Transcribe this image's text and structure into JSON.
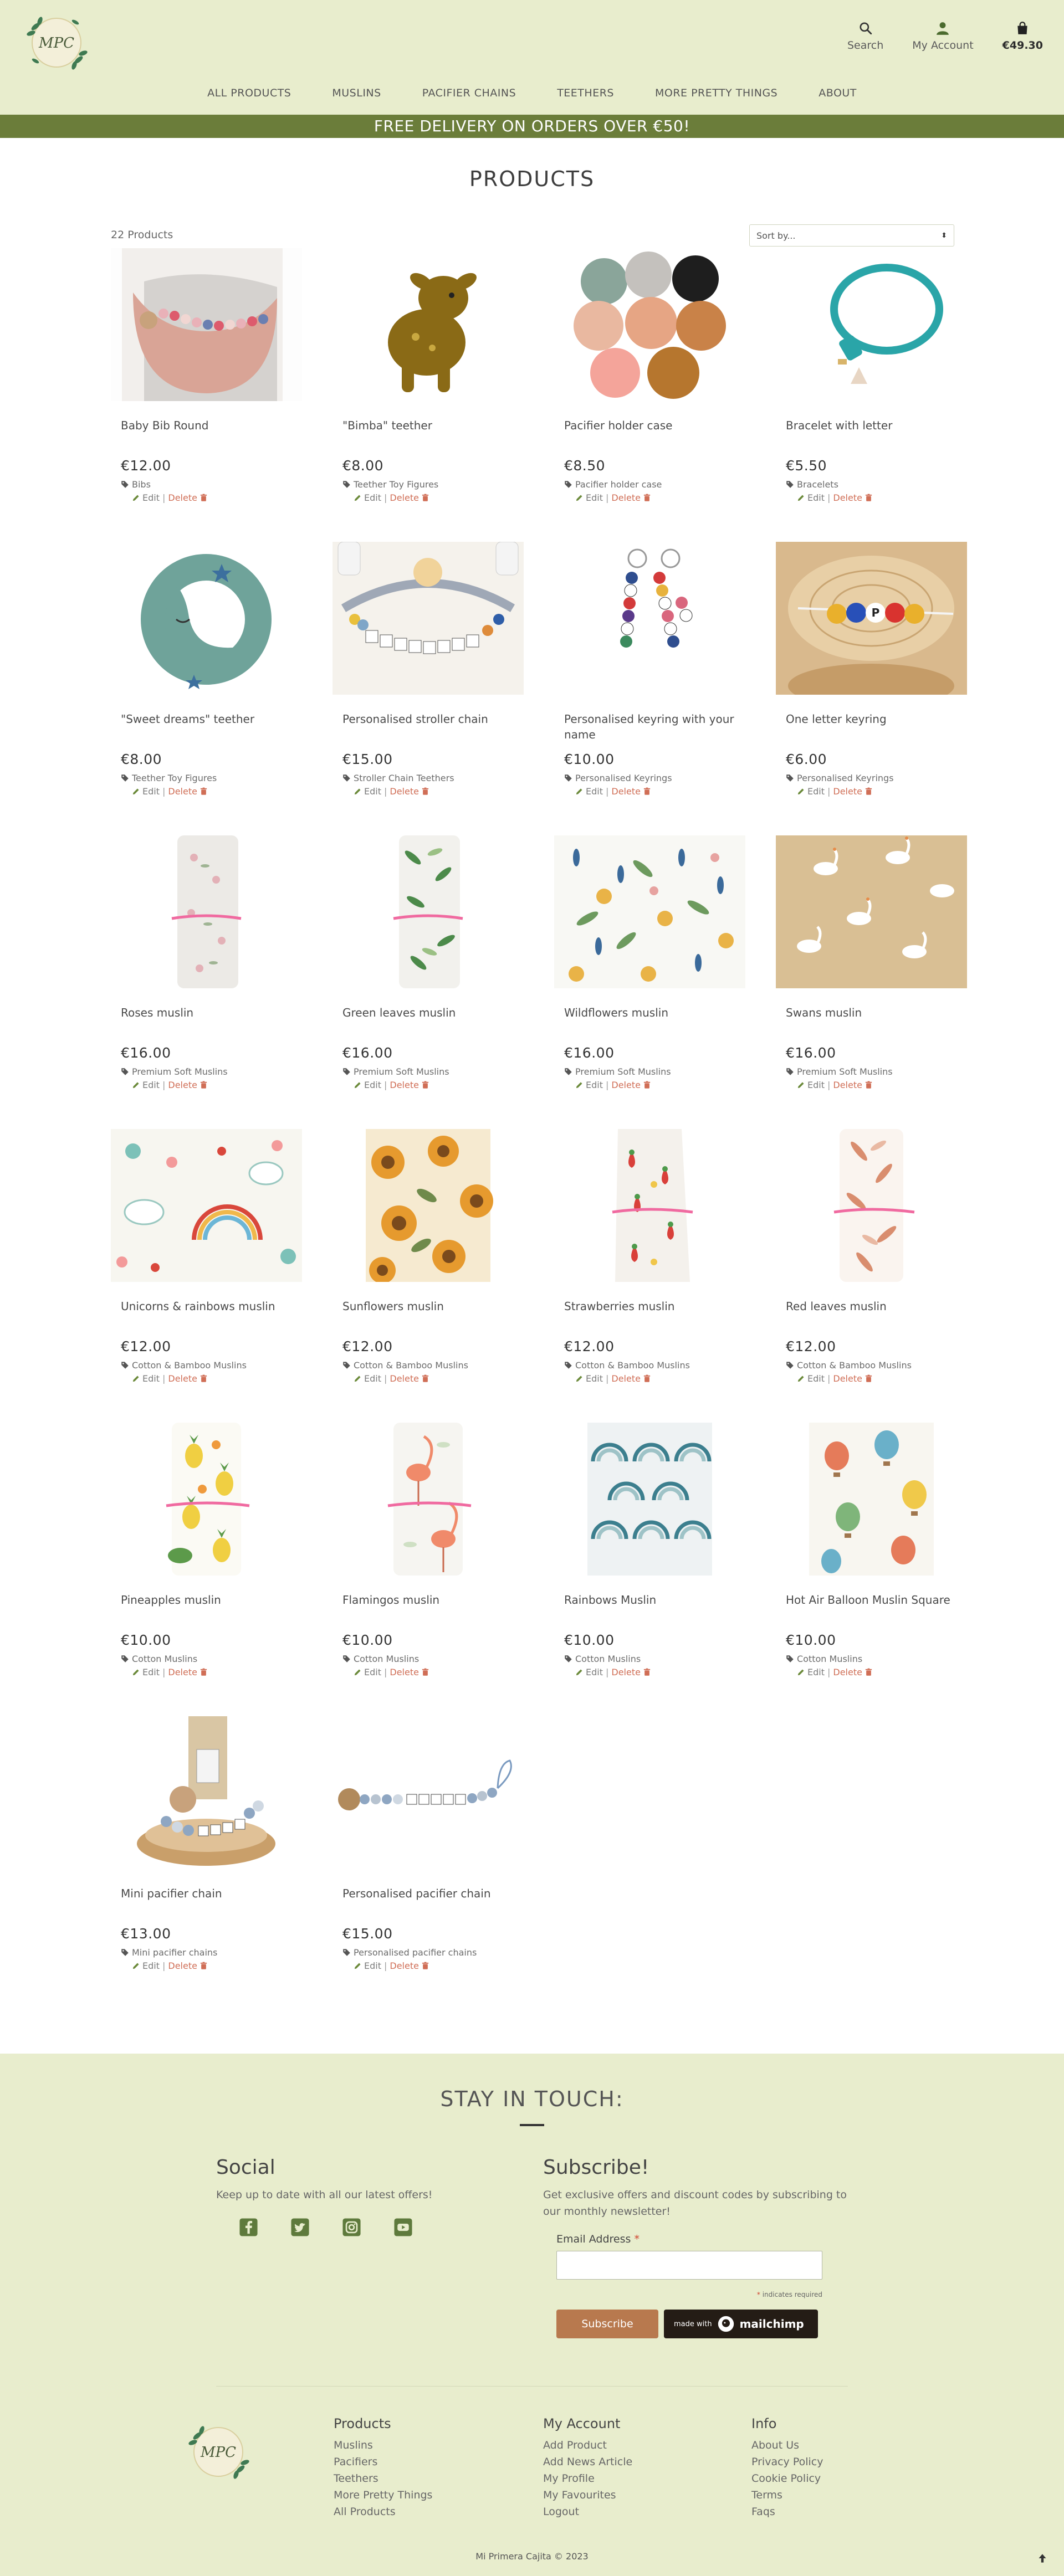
{
  "header": {
    "logo_text": "MPC",
    "actions": [
      {
        "label": "Search",
        "icon": "search-icon"
      },
      {
        "label": "My Account",
        "icon": "user-icon"
      },
      {
        "label": "€49.30",
        "icon": "shopping-bag-icon"
      }
    ],
    "nav": [
      "ALL PRODUCTS",
      "MUSLINS",
      "PACIFIER CHAINS",
      "TEETHERS",
      "MORE PRETTY THINGS",
      "ABOUT"
    ],
    "promo": "FREE DELIVERY ON ORDERS OVER €50!"
  },
  "page": {
    "title": "PRODUCTS",
    "count": "22 Products",
    "sort_placeholder": "Sort by..."
  },
  "admin": {
    "edit": "Edit",
    "sep": "|",
    "delete": "Delete"
  },
  "products": [
    {
      "name": "Baby Bib Round",
      "price": "€12.00",
      "category": "Bibs",
      "image": "bib"
    },
    {
      "name": "\"Bimba\" teether",
      "price": "€8.00",
      "category": "Teether Toy Figures",
      "image": "deer"
    },
    {
      "name": "Pacifier holder case",
      "price": "€8.50",
      "category": "Pacifier holder case",
      "image": "cases"
    },
    {
      "name": "Bracelet with letter",
      "price": "€5.50",
      "category": "Bracelets",
      "image": "bracelet"
    },
    {
      "name": "\"Sweet dreams\" teether",
      "price": "€8.00",
      "category": "Teether Toy Figures",
      "image": "moon"
    },
    {
      "name": "Personalised stroller chain",
      "price": "€15.00",
      "category": "Stroller Chain Teethers",
      "image": "stroller"
    },
    {
      "name": "Personalised keyring with your name",
      "price": "€10.00",
      "category": "Personalised Keyrings",
      "image": "keyrings"
    },
    {
      "name": "One letter keyring",
      "price": "€6.00",
      "category": "Personalised Keyrings",
      "image": "wood"
    },
    {
      "name": "Roses muslin",
      "price": "€16.00",
      "category": "Premium Soft Muslins",
      "image": "muslin-roses"
    },
    {
      "name": "Green leaves muslin",
      "price": "€16.00",
      "category": "Premium Soft Muslins",
      "image": "muslin-green"
    },
    {
      "name": "Wildflowers muslin",
      "price": "€16.00",
      "category": "Premium Soft Muslins",
      "image": "wildflowers"
    },
    {
      "name": "Swans muslin",
      "price": "€16.00",
      "category": "Premium Soft Muslins",
      "image": "swans"
    },
    {
      "name": "Unicorns & rainbows muslin",
      "price": "€12.00",
      "category": "Cotton & Bamboo Muslins",
      "image": "unicorns"
    },
    {
      "name": "Sunflowers muslin",
      "price": "€12.00",
      "category": "Cotton & Bamboo Muslins",
      "image": "sunflowers"
    },
    {
      "name": "Strawberries muslin",
      "price": "€12.00",
      "category": "Cotton & Bamboo Muslins",
      "image": "strawberries"
    },
    {
      "name": "Red leaves muslin",
      "price": "€12.00",
      "category": "Cotton & Bamboo Muslins",
      "image": "red-leaves"
    },
    {
      "name": "Pineapples muslin",
      "price": "€10.00",
      "category": "Cotton Muslins",
      "image": "pineapples"
    },
    {
      "name": "Flamingos muslin",
      "price": "€10.00",
      "category": "Cotton Muslins",
      "image": "flamingos"
    },
    {
      "name": "Rainbows Muslin",
      "price": "€10.00",
      "category": "Cotton Muslins",
      "image": "rainbows"
    },
    {
      "name": "Hot Air Balloon Muslin Square",
      "price": "€10.00",
      "category": "Cotton Muslins",
      "image": "balloons"
    },
    {
      "name": "Mini pacifier chain",
      "price": "€13.00",
      "category": "Mini pacifier chains",
      "image": "mini-chain"
    },
    {
      "name": "Personalised pacifier chain",
      "price": "€15.00",
      "category": "Personalised pacifier chains",
      "image": "pacifier-chain"
    }
  ],
  "footer": {
    "stay_title": "STAY IN TOUCH:",
    "social_title": "Social",
    "social_text": "Keep up to date with all our latest offers!",
    "social_icons": [
      "facebook-icon",
      "twitter-icon",
      "instagram-icon",
      "youtube-icon"
    ],
    "subscribe_title": "Subscribe!",
    "subscribe_text": "Get exclusive offers and discount codes by subscribing to our monthly newsletter!",
    "email_label": "Email Address",
    "required_mark": "*",
    "required_note": "indicates required",
    "subscribe_button": "Subscribe",
    "mailchimp_made": "made with",
    "mailchimp_brand": "mailchimp",
    "columns": [
      {
        "title": "Products",
        "links": [
          "Muslins",
          "Pacifiers",
          "Teethers",
          "More Pretty Things",
          "All Products"
        ]
      },
      {
        "title": "My Account",
        "links": [
          "Add Product",
          "Add News Article",
          "My Profile",
          "My Favourites",
          "Logout"
        ]
      },
      {
        "title": "Info",
        "links": [
          "About Us",
          "Privacy Policy",
          "Cookie Policy",
          "Terms",
          "Faqs"
        ]
      }
    ],
    "copyright": "Mi Primera Cajita © 2023"
  },
  "colors": {
    "header_bg": "#e8edcd",
    "promo_bg": "#6b7d3a",
    "delete": "#d06e56",
    "subscribe": "#b8794e"
  }
}
